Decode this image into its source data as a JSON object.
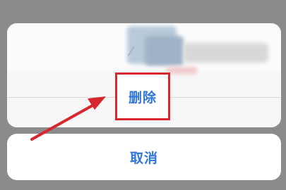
{
  "action_sheet": {
    "delete_label": "删除",
    "cancel_label": "取消"
  },
  "colors": {
    "overlay": "#8b8b8b",
    "sheet_background": "#f7f7f7",
    "action_text": "#2f76d8",
    "highlight": "#d7262e"
  },
  "icons": {
    "annotation": "red-arrow-icon"
  }
}
